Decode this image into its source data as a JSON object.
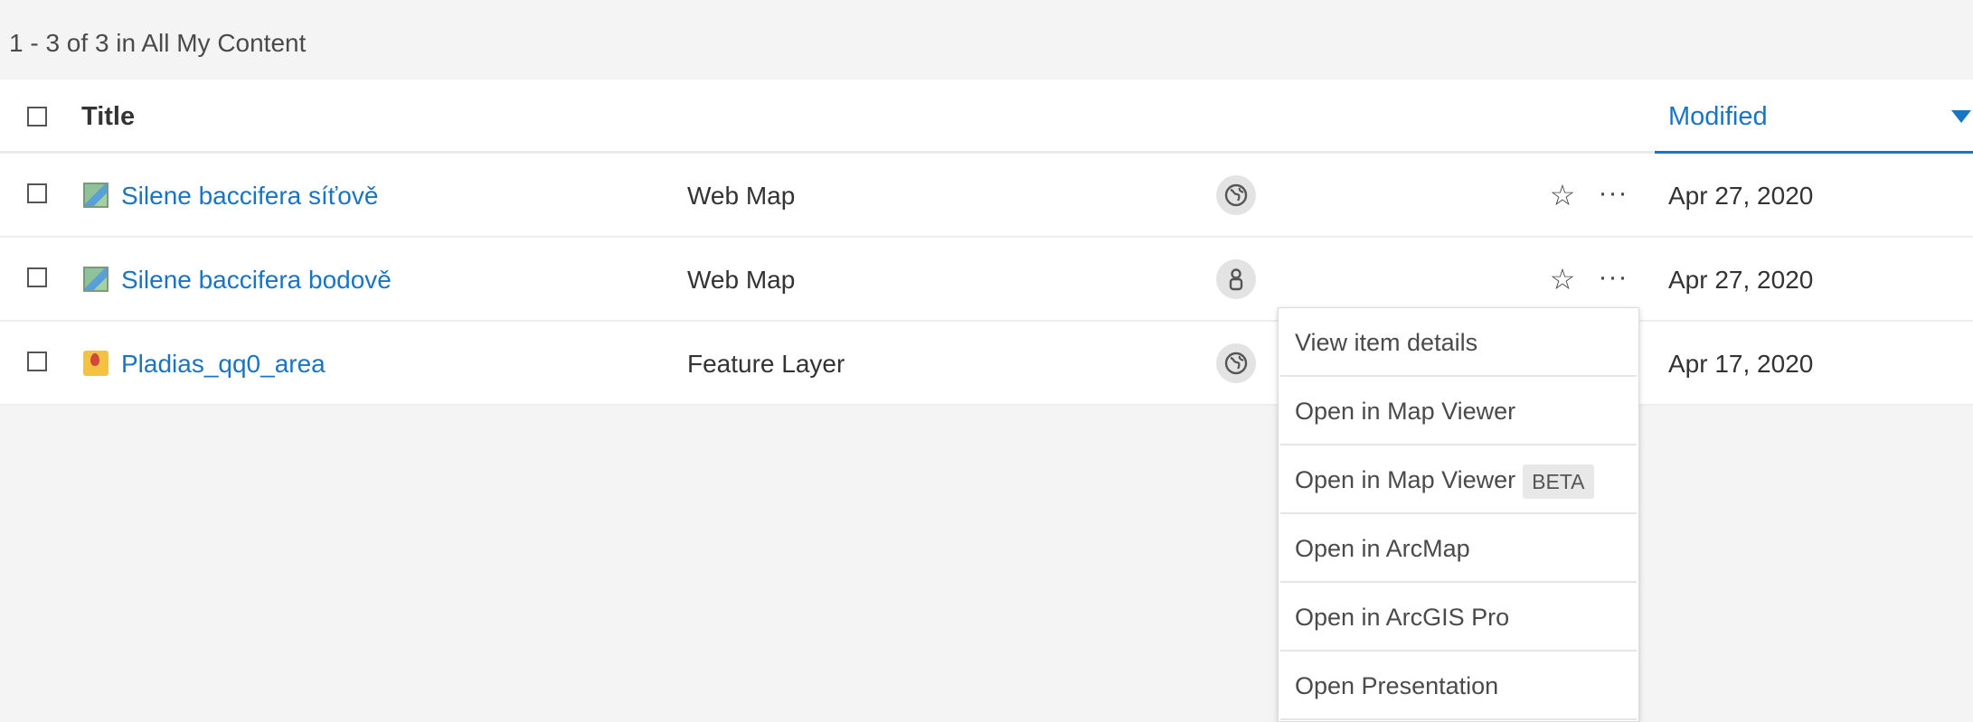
{
  "summary": "1 - 3 of 3 in All My Content",
  "table": {
    "headers": {
      "title": "Title",
      "modified": "Modified"
    },
    "rows": [
      {
        "title": "Silene baccifera síťově",
        "type": "Web Map",
        "sharing": "globe-icon",
        "modified": "Apr 27, 2020",
        "item_icon": "web-map-icon"
      },
      {
        "title": "Silene baccifera bodově",
        "type": "Web Map",
        "sharing": "person-icon",
        "modified": "Apr 27, 2020",
        "item_icon": "web-map-icon"
      },
      {
        "title": "Pladias_qq0_area",
        "type": "Feature Layer",
        "sharing": "globe-icon",
        "modified": "Apr 17, 2020",
        "item_icon": "feature-layer-icon"
      }
    ]
  },
  "context_menu": {
    "items": [
      {
        "label": "View item details"
      },
      {
        "label": "Open in Map Viewer"
      },
      {
        "label": "Open in Map Viewer",
        "badge": "BETA"
      },
      {
        "label": "Open in ArcMap"
      },
      {
        "label": "Open in ArcGIS Pro"
      },
      {
        "label": "Open Presentation"
      }
    ]
  },
  "colors": {
    "accent": "#1a74c4",
    "background": "#f4f4f4"
  }
}
